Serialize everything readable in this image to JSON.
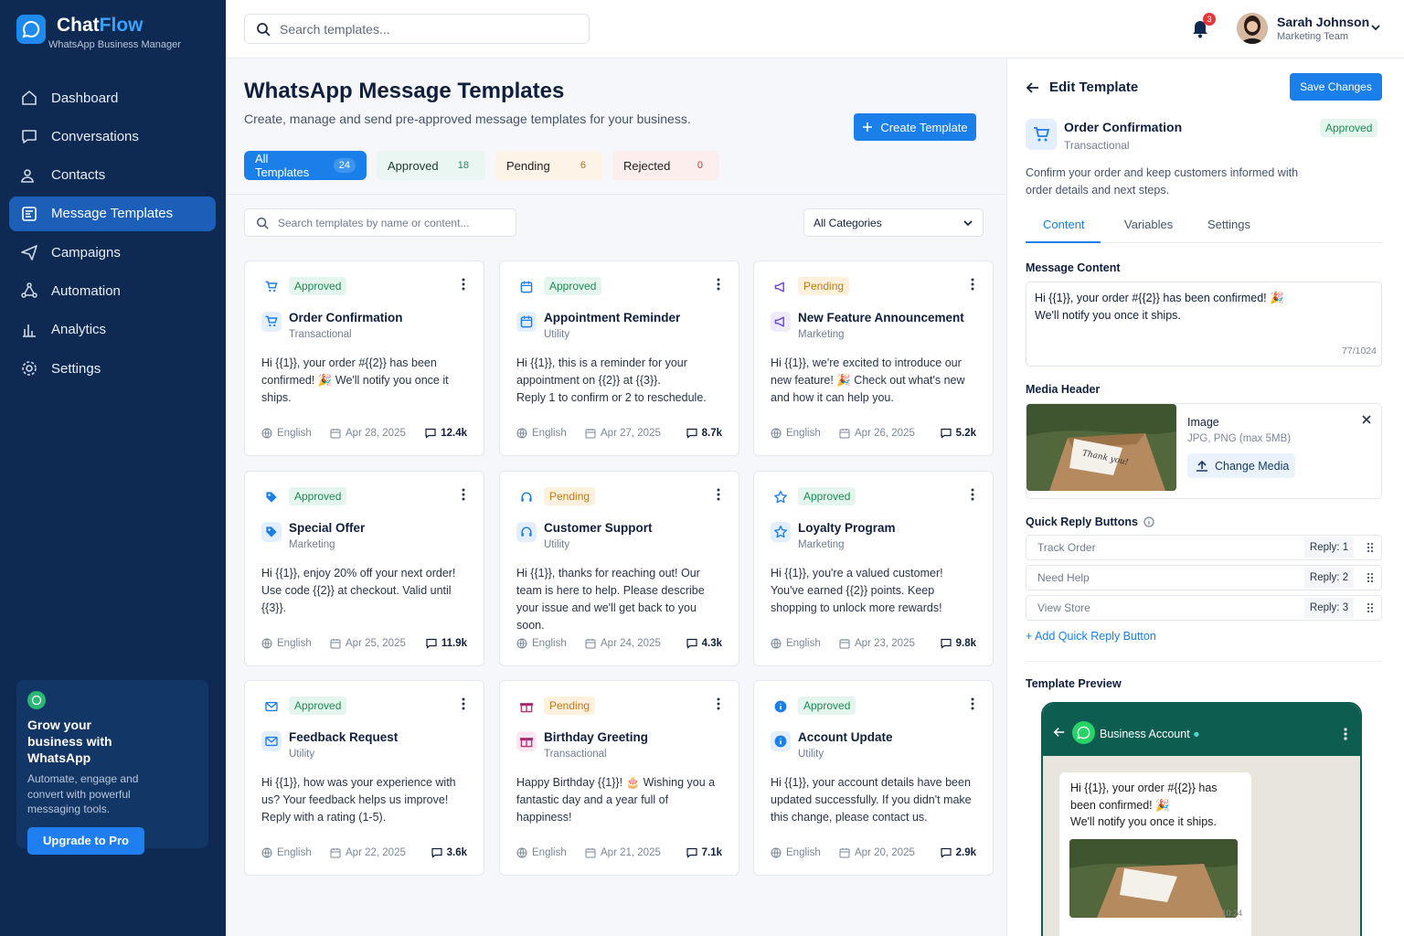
{
  "brand": {
    "name_a": "Chat",
    "name_b": "Flow",
    "subtitle": "WhatsApp Business Manager"
  },
  "sidebar": {
    "items": [
      {
        "label": "Dashboard",
        "icon": "home-icon"
      },
      {
        "label": "Conversations",
        "icon": "chat-icon"
      },
      {
        "label": "Contacts",
        "icon": "users-icon"
      },
      {
        "label": "Message Templates",
        "icon": "template-icon",
        "active": true
      },
      {
        "label": "Campaigns",
        "icon": "send-icon"
      },
      {
        "label": "Automation",
        "icon": "automation-icon"
      },
      {
        "label": "Analytics",
        "icon": "analytics-icon"
      },
      {
        "label": "Settings",
        "icon": "gear-icon"
      }
    ],
    "promo": {
      "title": "Grow your business with WhatsApp",
      "text": "Automate, engage and convert with powerful messaging tools.",
      "button": "Upgrade to Pro"
    }
  },
  "topbar": {
    "search_placeholder": "Search templates...",
    "notifications": "3",
    "user": {
      "name": "Sarah Johnson",
      "team": "Marketing Team"
    }
  },
  "main": {
    "title": "WhatsApp Message Templates",
    "subtitle": "Create, manage and send pre-approved message templates for your business.",
    "create_button": "Create Template",
    "filters": [
      {
        "label": "All Templates",
        "count": "24"
      },
      {
        "label": "Approved",
        "count": "18"
      },
      {
        "label": "Pending",
        "count": "6"
      },
      {
        "label": "Rejected",
        "count": "0"
      }
    ],
    "list_search_placeholder": "Search templates by name or content...",
    "category_select": "All Categories",
    "cards": [
      {
        "status": "Approved",
        "title": "Order Confirmation",
        "category": "Transactional",
        "body": "Hi {{1}}, your order #{{2}} has been confirmed! 🎉 We'll notify you once it ships.",
        "language": "English",
        "date": "Apr 28, 2025",
        "sent": "12.4k",
        "icon": "cart-icon"
      },
      {
        "status": "Approved",
        "title": "Appointment Reminder",
        "category": "Utility",
        "body": "Hi {{1}}, this is a reminder for your appointment on {{2}} at {{3}}.\nReply 1 to confirm or 2 to reschedule.",
        "language": "English",
        "date": "Apr 27, 2025",
        "sent": "8.7k",
        "icon": "calendar-icon"
      },
      {
        "status": "Pending",
        "title": "New Feature Announcement",
        "category": "Marketing",
        "body": "Hi {{1}}, we're excited to introduce our new feature! 🎉 Check out what's new and how it can help you.",
        "language": "English",
        "date": "Apr 26, 2025",
        "sent": "5.2k",
        "icon": "megaphone-icon"
      },
      {
        "status": "Approved",
        "title": "Special Offer",
        "category": "Marketing",
        "body": "Hi {{1}}, enjoy 20% off your next order! Use code {{2}} at checkout. Valid until {{3}}.",
        "language": "English",
        "date": "Apr 25, 2025",
        "sent": "11.9k",
        "icon": "tag-icon"
      },
      {
        "status": "Pending",
        "title": "Customer Support",
        "category": "Utility",
        "body": "Hi {{1}}, thanks for reaching out! Our team is here to help. Please describe your issue and we'll get back to you soon.",
        "language": "English",
        "date": "Apr 24, 2025",
        "sent": "4.3k",
        "icon": "headset-icon"
      },
      {
        "status": "Approved",
        "title": "Loyalty Program",
        "category": "Marketing",
        "body": "Hi {{1}}, you're a valued customer! You've earned {{2}} points. Keep shopping to unlock more rewards!",
        "language": "English",
        "date": "Apr 23, 2025",
        "sent": "9.8k",
        "icon": "star-icon"
      },
      {
        "status": "Approved",
        "title": "Feedback Request",
        "category": "Utility",
        "body": "Hi {{1}}, how was your experience with us? Your feedback helps us improve! Reply with a rating (1-5).",
        "language": "English",
        "date": "Apr 22, 2025",
        "sent": "3.6k",
        "icon": "mail-icon"
      },
      {
        "status": "Pending",
        "title": "Birthday Greeting",
        "category": "Transactional",
        "body": "Happy Birthday {{1}}! 🎂 Wishing you a fantastic day and a year full of happiness!",
        "language": "English",
        "date": "Apr 21, 2025",
        "sent": "7.1k",
        "icon": "gift-icon"
      },
      {
        "status": "Approved",
        "title": "Account Update",
        "category": "Utility",
        "body": "Hi {{1}}, your account details have been updated successfully. If you didn't make this change, please contact us.",
        "language": "English",
        "date": "Apr 20, 2025",
        "sent": "2.9k",
        "icon": "info-icon"
      }
    ]
  },
  "editor": {
    "title": "Edit Template",
    "save_button": "Save Changes",
    "template_name": "Order Confirmation",
    "template_category": "Transactional",
    "status": "Approved",
    "description": "Confirm your order and keep customers informed with order details and next steps.",
    "tabs": [
      "Content",
      "Variables",
      "Settings"
    ],
    "message_label": "Message Content",
    "message_line1": "Hi {{1}}, your order #{{2}} has been confirmed! 🎉",
    "message_line2": "We'll notify you once it ships.",
    "char_count": "77/1024",
    "media_label": "Media Header",
    "media_type": "Image",
    "media_hint": "JPG, PNG (max 5MB)",
    "media_button": "Change Media",
    "quick_label": "Quick Reply Buttons",
    "quick_replies": [
      {
        "text": "Track Order",
        "reply": "Reply: 1"
      },
      {
        "text": "Need Help",
        "reply": "Reply: 2"
      },
      {
        "text": "View Store",
        "reply": "Reply: 3"
      }
    ],
    "add_quick": "Add Quick Reply Button",
    "preview_label": "Template Preview",
    "preview": {
      "account": "Business Account",
      "line1": "Hi {{1}}, your order #{{2}} has been confirmed! 🎉",
      "line2": "We'll notify you once it ships.",
      "time": "10:24",
      "card_text": "Thank you!"
    }
  },
  "colors": {
    "sidebar": "#0e2a52",
    "accent": "#1a7fe8",
    "approved": "#1f8a55",
    "pending": "#c27a13",
    "whatsapp": "#0d5e51"
  }
}
